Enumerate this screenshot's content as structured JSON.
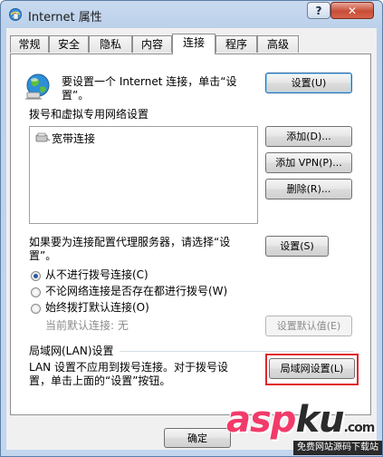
{
  "window": {
    "title": "Internet 属性",
    "help_label": "?",
    "close_label": "✕"
  },
  "tabs": [
    {
      "label": "常规"
    },
    {
      "label": "安全"
    },
    {
      "label": "隐私"
    },
    {
      "label": "内容"
    },
    {
      "label": "连接"
    },
    {
      "label": "程序"
    },
    {
      "label": "高级"
    }
  ],
  "active_tab": "连接",
  "setup": {
    "text_line1": "要设置一个 Internet 连接，单击“设",
    "text_line2": "置”。",
    "button": "设置(U)"
  },
  "dialup": {
    "section_label": "拨号和虚拟专用网络设置",
    "connections": [
      "宽带连接"
    ],
    "add_button": "添加(D)...",
    "add_vpn_button": "添加 VPN(P)...",
    "delete_button": "删除(R)...",
    "proxy_text_line1": "如果要为连接配置代理服务器，请选择“设",
    "proxy_text_line2": "置”。",
    "settings_button": "设置(S)",
    "options": [
      {
        "label": "从不进行拨号连接(C)",
        "checked": true
      },
      {
        "label": "不论网络连接是否存在都进行拨号(W)",
        "checked": false
      },
      {
        "label": "始终拨打默认连接(O)",
        "checked": false
      }
    ],
    "current_default_label": "当前默认连接:",
    "current_default_value": "无",
    "set_default_button": "设置默认值(E)"
  },
  "lan": {
    "section_label": "局域网(LAN)设置",
    "text_line1": "LAN 设置不应用到拨号连接。对于拨号设",
    "text_line2": "置，单击上面的“设置”按钮。",
    "button": "局域网设置(L)"
  },
  "footer": {
    "ok_button": "确定"
  },
  "watermark": {
    "logo_part1": "asp",
    "logo_part2": "ku",
    "logo_suffix": ".com",
    "subtitle": "免费网站源码下载站"
  }
}
